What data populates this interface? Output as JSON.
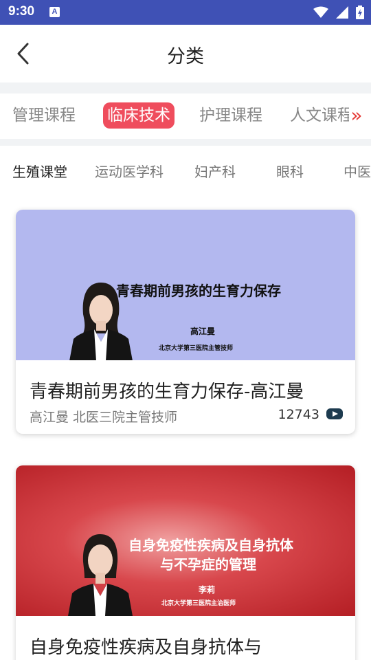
{
  "status_bar": {
    "time": "9:30",
    "notification_letter": "A",
    "bg_color": "#3f51b5"
  },
  "header": {
    "title": "分类",
    "back_icon": "chevron-left-icon"
  },
  "category_tabs": {
    "items": [
      "管理课程",
      "临床技术",
      "护理课程",
      "人文课程"
    ],
    "active_index": 1,
    "more_icon": "double-chevron-right-icon",
    "active_color": "#ef4d5d"
  },
  "sub_tabs": {
    "items": [
      "生殖课堂",
      "运动医学科",
      "妇产科",
      "眼科",
      "中医"
    ],
    "active_index": 0
  },
  "courses": [
    {
      "thumb_title": "青春期前男孩的生育力保存",
      "thumb_speaker": "高江曼",
      "thumb_affiliation": "北京大学第三医院主管技师",
      "title": "青春期前男孩的生育力保存-高江曼",
      "subtitle": "高江曼 北医三院主管技师",
      "views": "12743",
      "thumb_bg": "#b3b8ef"
    },
    {
      "thumb_title_line1": "自身免疫性疾病及自身抗体",
      "thumb_title_line2": "与不孕症的管理",
      "thumb_speaker": "李莉",
      "thumb_affiliation": "北京大学第三医院主治医师",
      "title": "自身免疫性疾病及自身抗体与"
    }
  ]
}
